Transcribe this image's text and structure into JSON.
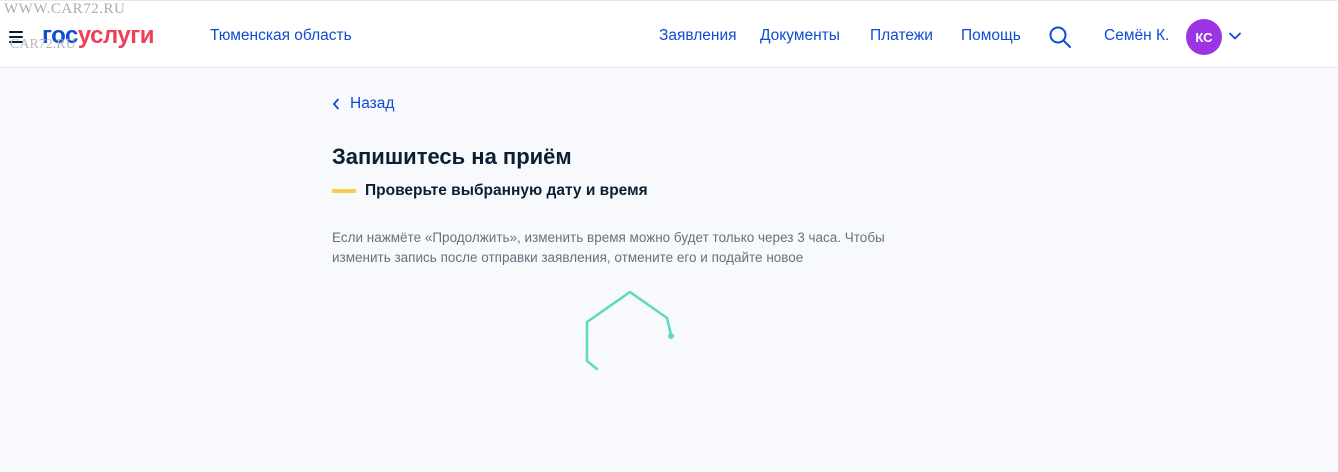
{
  "watermark": {
    "top_text": "WWW.CAR72.RU",
    "bottom_text": "CAR72.RU"
  },
  "header": {
    "menu_icon": "hamburger-icon",
    "logo": {
      "part1": "гос",
      "part2": "услуги"
    },
    "region": "Тюменская область",
    "nav": [
      "Заявления",
      "Документы",
      "Платежи",
      "Помощь"
    ],
    "search_icon": "search-icon",
    "user_name": "Семён К.",
    "avatar_initials": "КС",
    "user_menu_icon": "chevron-down-icon"
  },
  "main": {
    "back_label": "Назад",
    "title": "Запишитесь на приём",
    "step_label": "Проверьте выбранную дату и время",
    "info_line1": "Если нажмёте «Продолжить», изменить время можно будет только через 3 часа. Чтобы",
    "info_line2": "изменить запись после отправки заявления, отмените его и подайте новое",
    "loader_icon": "hexagon-spinner-icon"
  },
  "colors": {
    "brand_blue": "#0d4cd3",
    "brand_red": "#ee3f58",
    "avatar_bg": "#9b34e4",
    "step_accent": "#f6ce4c",
    "spinner": "#5fd8c0",
    "background": "#f7f9fd"
  }
}
